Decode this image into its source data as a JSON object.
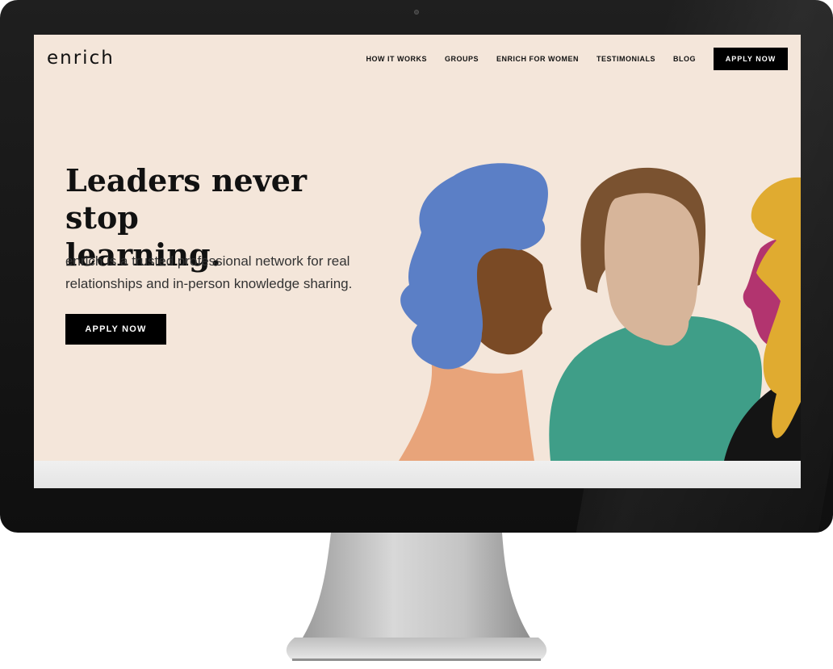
{
  "site": {
    "logo": "enrich"
  },
  "nav": {
    "links": [
      "HOW IT WORKS",
      "GROUPS",
      "ENRICH FOR WOMEN",
      "TESTIMONIALS",
      "BLOG"
    ],
    "apply_label": "APPLY NOW"
  },
  "hero": {
    "title_line1": "Leaders never stop",
    "title_line2": "learning.",
    "subtitle_line1": "enrich is a trusted professional network for real",
    "subtitle_line2": "relationships and in-person knowledge sharing.",
    "apply_label": "APPLY NOW"
  },
  "colors": {
    "background": "#f4e6da",
    "blue_hair": "#5b7fc6",
    "brown_skin": "#7a4a25",
    "peach_neck": "#e8a47a",
    "tan_face": "#d7b59a",
    "brown_hair": "#7a5230",
    "teal_shirt": "#3f9e88",
    "yellow_hair": "#e0ab30",
    "magenta_face": "#b2346f",
    "black_shirt": "#141414"
  },
  "icons": [
    "webcam-icon"
  ]
}
